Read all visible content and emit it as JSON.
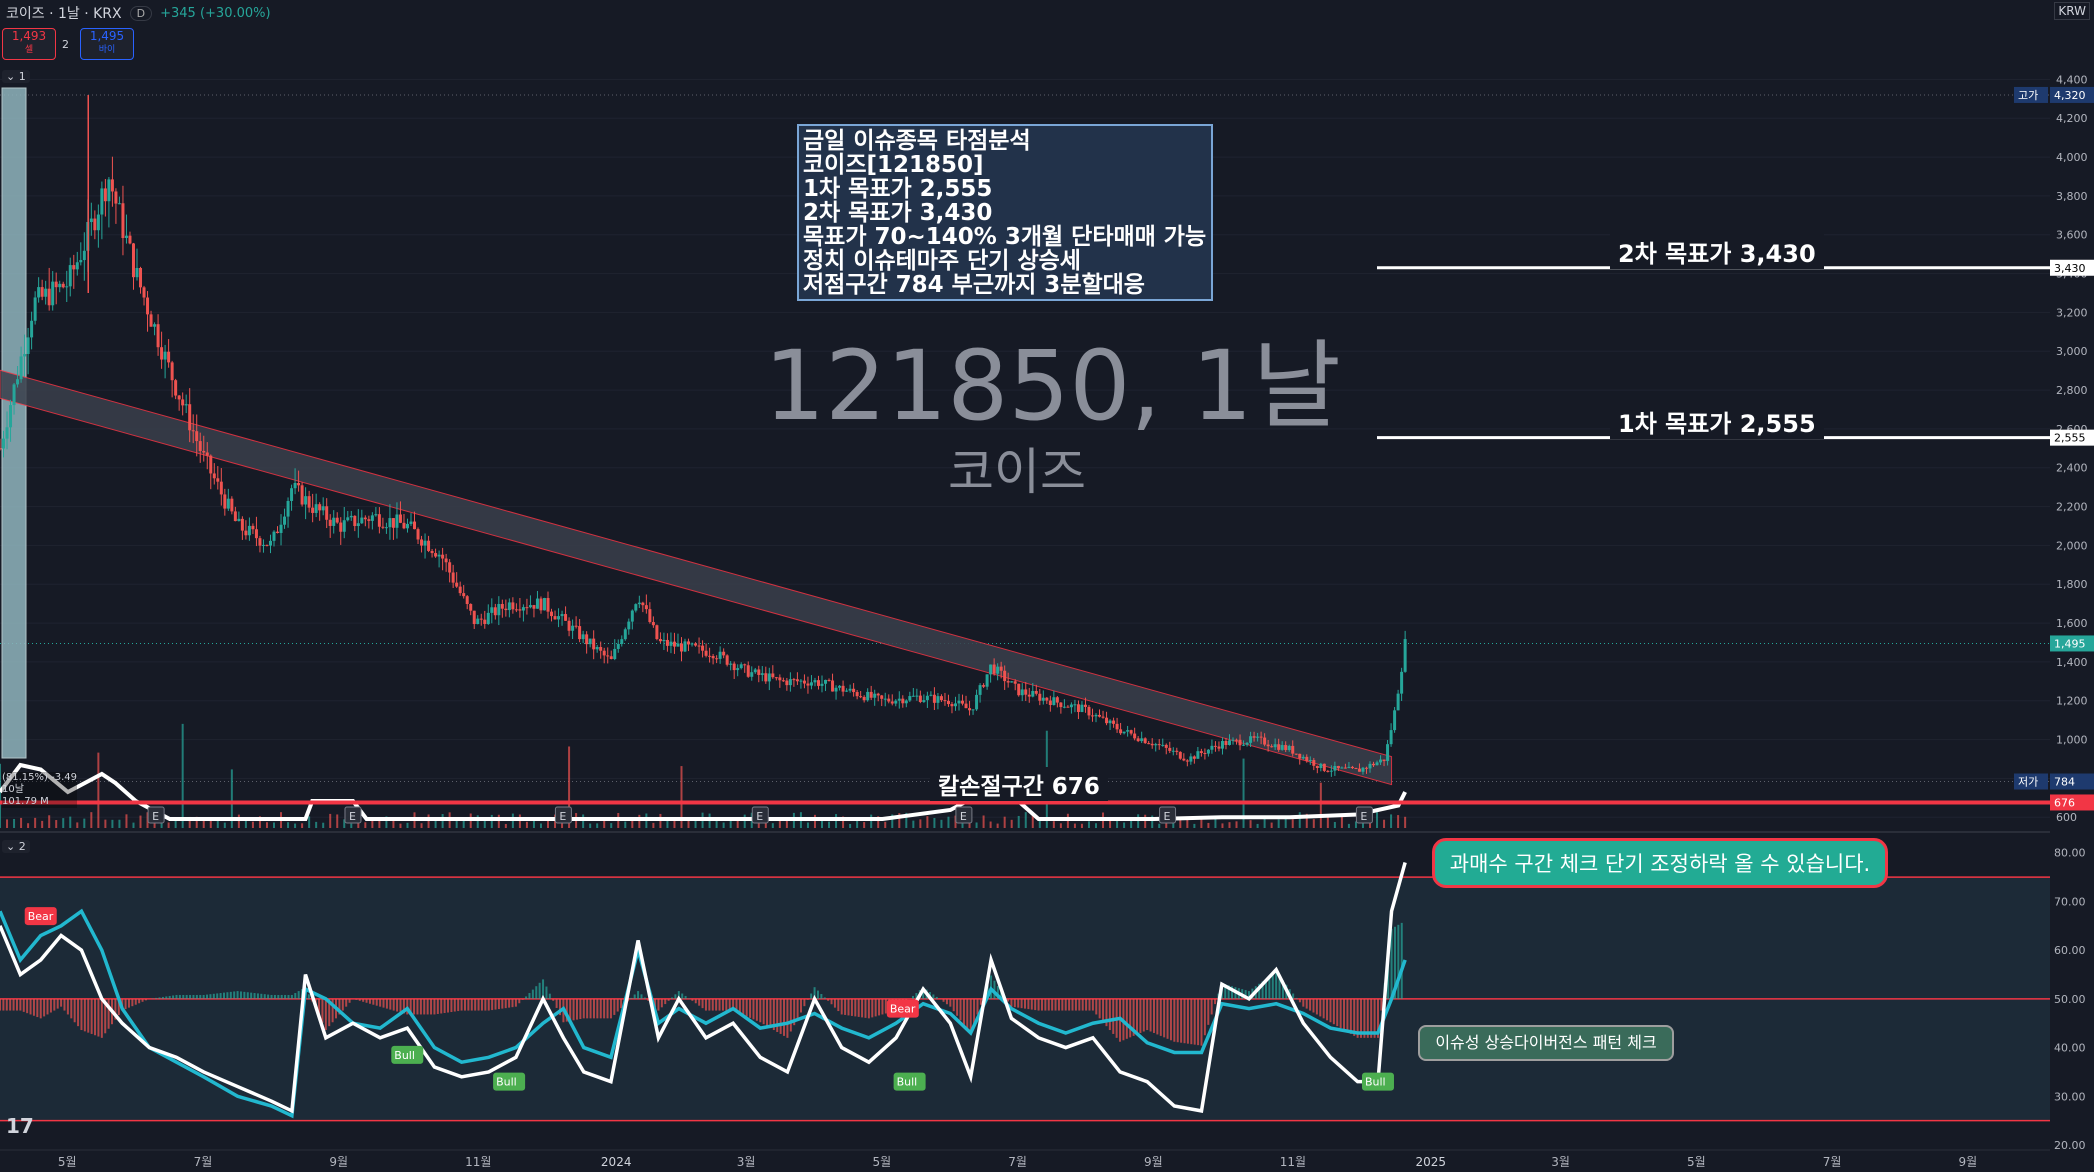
{
  "header": {
    "title": "코이즈 · 1날 · KRX",
    "badge": "D",
    "change": "+345 (+30.00%)",
    "sell_price": "1,493",
    "sell_label": "셀",
    "spread": "2",
    "buy_price": "1,495",
    "buy_label": "바이",
    "currency": "KRW",
    "pane1_tag": "1",
    "pane2_tag": "2",
    "logo": "17"
  },
  "info_box": {
    "lines": [
      "금일 이슈종목 타점분석",
      "코이즈[121850]",
      "1차 목표가 2,555",
      "2차 목표가 3,430",
      "목표가 70~140% 3개월 단타매매 가능",
      "정치 이슈테마주 단기 상승세",
      "저점구간 784 부근까지 3분할대응"
    ]
  },
  "watermark": {
    "symbol": "121850, 1날",
    "name": "코이즈"
  },
  "levels": {
    "target2_label": "2차 목표가 3,430",
    "target1_label": "1차 목표가 2,555",
    "stop_label": "칼손절구간 676"
  },
  "callouts": {
    "overbought": "과매수 구간 체크 단기 조정하락 올 수 있습니다.",
    "divergence": "이슈성 상승다이버전스 패턴 체크"
  },
  "indicator_labels": {
    "vol_line1": "(81.15%) -3.49",
    "vol_line2": "10날",
    "vol_line3": "101.79 M"
  },
  "chart_data": [
    {
      "type": "candlestick",
      "ylim": [
        560,
        4500
      ],
      "price_axis": [
        "4,400",
        "4,200",
        "4,000",
        "3,800",
        "3,600",
        "3,400",
        "3,200",
        "3,000",
        "2,800",
        "2,600",
        "2,400",
        "2,200",
        "2,000",
        "1,800",
        "1,600",
        "1,400",
        "1,200",
        "1,000",
        "800",
        "600"
      ],
      "price_axis_values": [
        4400,
        4200,
        4000,
        3800,
        3600,
        3400,
        3200,
        3000,
        2800,
        2600,
        2400,
        2200,
        2000,
        1800,
        1600,
        1400,
        1200,
        1000,
        800,
        600
      ],
      "x_axis": [
        "5월",
        "7월",
        "9월",
        "11월",
        "2024",
        "3월",
        "5월",
        "7월",
        "9월",
        "11월",
        "2025",
        "3월",
        "5월",
        "7월",
        "9월"
      ],
      "x_axis_months": [
        4,
        6,
        8,
        10,
        12,
        14,
        16,
        18,
        20,
        22,
        24,
        26,
        28,
        30,
        32
      ],
      "x_range_months": [
        3,
        33.2
      ],
      "marker_tags": [
        {
          "label": "고가",
          "value": "4,320",
          "price": 4320,
          "color": "#1e3a6e"
        },
        {
          "label": "",
          "value": "3,430",
          "price": 3430,
          "color": "#ffffff"
        },
        {
          "label": "",
          "value": "2,555",
          "price": 2555,
          "color": "#ffffff"
        },
        {
          "label": "",
          "value": "1,495",
          "price": 1495,
          "color": "#26a69a"
        },
        {
          "label": "저가",
          "value": "784",
          "price": 784,
          "color": "#1e3a6e"
        },
        {
          "label": "",
          "value": "676",
          "price": 676,
          "color": "#f23645"
        }
      ],
      "last_price": 1495,
      "high": 4320,
      "low": 784,
      "target1": 2555,
      "target2": 3430,
      "stop": 676,
      "path": [
        [
          3.0,
          2500
        ],
        [
          3.5,
          3250
        ],
        [
          4.0,
          3350
        ],
        [
          4.3,
          3600
        ],
        [
          4.6,
          3900
        ],
        [
          5.0,
          3400
        ],
        [
          5.5,
          2900
        ],
        [
          6.0,
          2450
        ],
        [
          6.5,
          2100
        ],
        [
          7.0,
          2000
        ],
        [
          7.3,
          2300
        ],
        [
          7.6,
          2200
        ],
        [
          8.0,
          2100
        ],
        [
          8.5,
          2150
        ],
        [
          9.0,
          2100
        ],
        [
          9.5,
          1950
        ],
        [
          10.0,
          1600
        ],
        [
          10.5,
          1700
        ],
        [
          11.0,
          1700
        ],
        [
          11.5,
          1550
        ],
        [
          12.0,
          1400
        ],
        [
          12.4,
          1750
        ],
        [
          12.7,
          1500
        ],
        [
          13.5,
          1450
        ],
        [
          14.0,
          1350
        ],
        [
          14.5,
          1300
        ],
        [
          15.0,
          1300
        ],
        [
          15.5,
          1250
        ],
        [
          16.0,
          1200
        ],
        [
          16.5,
          1220
        ],
        [
          17.0,
          1200
        ],
        [
          17.3,
          1150
        ],
        [
          17.6,
          1380
        ],
        [
          18.0,
          1250
        ],
        [
          18.5,
          1200
        ],
        [
          19.0,
          1150
        ],
        [
          19.5,
          1050
        ],
        [
          20.0,
          980
        ],
        [
          20.5,
          900
        ],
        [
          21.0,
          980
        ],
        [
          21.5,
          1000
        ],
        [
          22.0,
          950
        ],
        [
          22.5,
          850
        ],
        [
          23.0,
          840
        ],
        [
          23.4,
          900
        ],
        [
          23.55,
          1150
        ],
        [
          23.7,
          1495
        ]
      ],
      "trend_channel": {
        "start": [
          3.0,
          2830
        ],
        "end": [
          23.5,
          840
        ],
        "width": 120
      },
      "volume_baseline": 600,
      "volume_line": [
        [
          3.0,
          640
        ],
        [
          3.3,
          670
        ],
        [
          3.6,
          665
        ],
        [
          4.0,
          640
        ],
        [
          4.5,
          660
        ],
        [
          4.7,
          650
        ],
        [
          5.0,
          630
        ],
        [
          5.5,
          610
        ],
        [
          7.5,
          610
        ],
        [
          7.6,
          630
        ],
        [
          8.2,
          630
        ],
        [
          8.4,
          610
        ],
        [
          10.0,
          610
        ],
        [
          12.0,
          610
        ],
        [
          14.0,
          610
        ],
        [
          16.0,
          610
        ],
        [
          17.0,
          620
        ],
        [
          17.5,
          640
        ],
        [
          18.0,
          630
        ],
        [
          18.3,
          610
        ],
        [
          20.0,
          610
        ],
        [
          21.0,
          612
        ],
        [
          22.0,
          612
        ],
        [
          23.0,
          615
        ],
        [
          23.6,
          625
        ],
        [
          23.7,
          640
        ]
      ],
      "earnings_marks": [
        5.3,
        8.2,
        11.3,
        14.2,
        17.2,
        20.2,
        23.1
      ]
    },
    {
      "type": "line",
      "ylim": [
        20,
        82
      ],
      "axis": [
        "80.00",
        "70.00",
        "60.00",
        "50.00",
        "40.00",
        "30.00",
        "20.00"
      ],
      "axis_values": [
        80,
        70,
        60,
        50,
        40,
        30,
        20
      ],
      "bands": [
        75,
        50,
        25
      ],
      "series": [
        {
          "values": [
            [
              3.0,
              68
            ],
            [
              3.3,
              58
            ],
            [
              3.6,
              63
            ],
            [
              3.9,
              65
            ],
            [
              4.2,
              68
            ],
            [
              4.5,
              60
            ],
            [
              4.8,
              48
            ],
            [
              5.2,
              40
            ],
            [
              5.6,
              37
            ],
            [
              6.0,
              34
            ],
            [
              6.5,
              30
            ],
            [
              7.0,
              28
            ],
            [
              7.3,
              26
            ],
            [
              7.5,
              52
            ],
            [
              7.8,
              50
            ],
            [
              8.2,
              45
            ],
            [
              8.6,
              44
            ],
            [
              9.0,
              48
            ],
            [
              9.4,
              40
            ],
            [
              9.8,
              37
            ],
            [
              10.2,
              38
            ],
            [
              10.6,
              40
            ],
            [
              11.0,
              45
            ],
            [
              11.3,
              48
            ],
            [
              11.6,
              40
            ],
            [
              12.0,
              38
            ],
            [
              12.4,
              60
            ],
            [
              12.7,
              45
            ],
            [
              13.0,
              48
            ],
            [
              13.4,
              45
            ],
            [
              13.8,
              48
            ],
            [
              14.2,
              44
            ],
            [
              14.6,
              45
            ],
            [
              15.0,
              47
            ],
            [
              15.4,
              44
            ],
            [
              15.8,
              42
            ],
            [
              16.2,
              45
            ],
            [
              16.6,
              49
            ],
            [
              17.0,
              47
            ],
            [
              17.3,
              43
            ],
            [
              17.6,
              52
            ],
            [
              17.9,
              48
            ],
            [
              18.3,
              45
            ],
            [
              18.7,
              43
            ],
            [
              19.1,
              45
            ],
            [
              19.5,
              46
            ],
            [
              19.9,
              41
            ],
            [
              20.3,
              39
            ],
            [
              20.7,
              39
            ],
            [
              21.0,
              49
            ],
            [
              21.4,
              48
            ],
            [
              21.8,
              49
            ],
            [
              22.2,
              47
            ],
            [
              22.6,
              44
            ],
            [
              23.0,
              43
            ],
            [
              23.3,
              43
            ],
            [
              23.5,
              50
            ],
            [
              23.7,
              58
            ]
          ]
        },
        {
          "values": [
            [
              3.0,
              65
            ],
            [
              3.3,
              55
            ],
            [
              3.6,
              58
            ],
            [
              3.9,
              63
            ],
            [
              4.2,
              60
            ],
            [
              4.5,
              50
            ],
            [
              4.8,
              45
            ],
            [
              5.2,
              40
            ],
            [
              5.6,
              38
            ],
            [
              6.0,
              35
            ],
            [
              6.5,
              32
            ],
            [
              7.0,
              29
            ],
            [
              7.3,
              27
            ],
            [
              7.5,
              55
            ],
            [
              7.8,
              42
            ],
            [
              8.2,
              45
            ],
            [
              8.6,
              42
            ],
            [
              9.0,
              44
            ],
            [
              9.4,
              36
            ],
            [
              9.8,
              34
            ],
            [
              10.2,
              35
            ],
            [
              10.6,
              38
            ],
            [
              11.0,
              50
            ],
            [
              11.3,
              42
            ],
            [
              11.6,
              35
            ],
            [
              12.0,
              33
            ],
            [
              12.4,
              62
            ],
            [
              12.7,
              42
            ],
            [
              13.0,
              50
            ],
            [
              13.4,
              42
            ],
            [
              13.8,
              45
            ],
            [
              14.2,
              38
            ],
            [
              14.6,
              35
            ],
            [
              15.0,
              50
            ],
            [
              15.4,
              40
            ],
            [
              15.8,
              37
            ],
            [
              16.2,
              42
            ],
            [
              16.6,
              52
            ],
            [
              17.0,
              45
            ],
            [
              17.3,
              34
            ],
            [
              17.6,
              58
            ],
            [
              17.9,
              46
            ],
            [
              18.3,
              42
            ],
            [
              18.7,
              40
            ],
            [
              19.1,
              42
            ],
            [
              19.5,
              35
            ],
            [
              19.9,
              33
            ],
            [
              20.3,
              28
            ],
            [
              20.7,
              27
            ],
            [
              21.0,
              53
            ],
            [
              21.4,
              50
            ],
            [
              21.8,
              56
            ],
            [
              22.2,
              45
            ],
            [
              22.6,
              38
            ],
            [
              23.0,
              33
            ],
            [
              23.3,
              33
            ],
            [
              23.5,
              68
            ],
            [
              23.7,
              78
            ]
          ]
        }
      ],
      "signals": [
        {
          "label": "Bear",
          "x": 3.6,
          "y": 67,
          "color": "#f23645"
        },
        {
          "label": "Bull",
          "x": 9.0,
          "y": 38.5,
          "color": "#4caf50"
        },
        {
          "label": "Bull",
          "x": 10.5,
          "y": 33,
          "color": "#4caf50"
        },
        {
          "label": "Bull",
          "x": 16.4,
          "y": 33,
          "color": "#4caf50"
        },
        {
          "label": "Bear",
          "x": 16.3,
          "y": 48,
          "color": "#f23645"
        },
        {
          "label": "Bull",
          "x": 23.3,
          "y": 33,
          "color": "#4caf50"
        }
      ]
    }
  ]
}
